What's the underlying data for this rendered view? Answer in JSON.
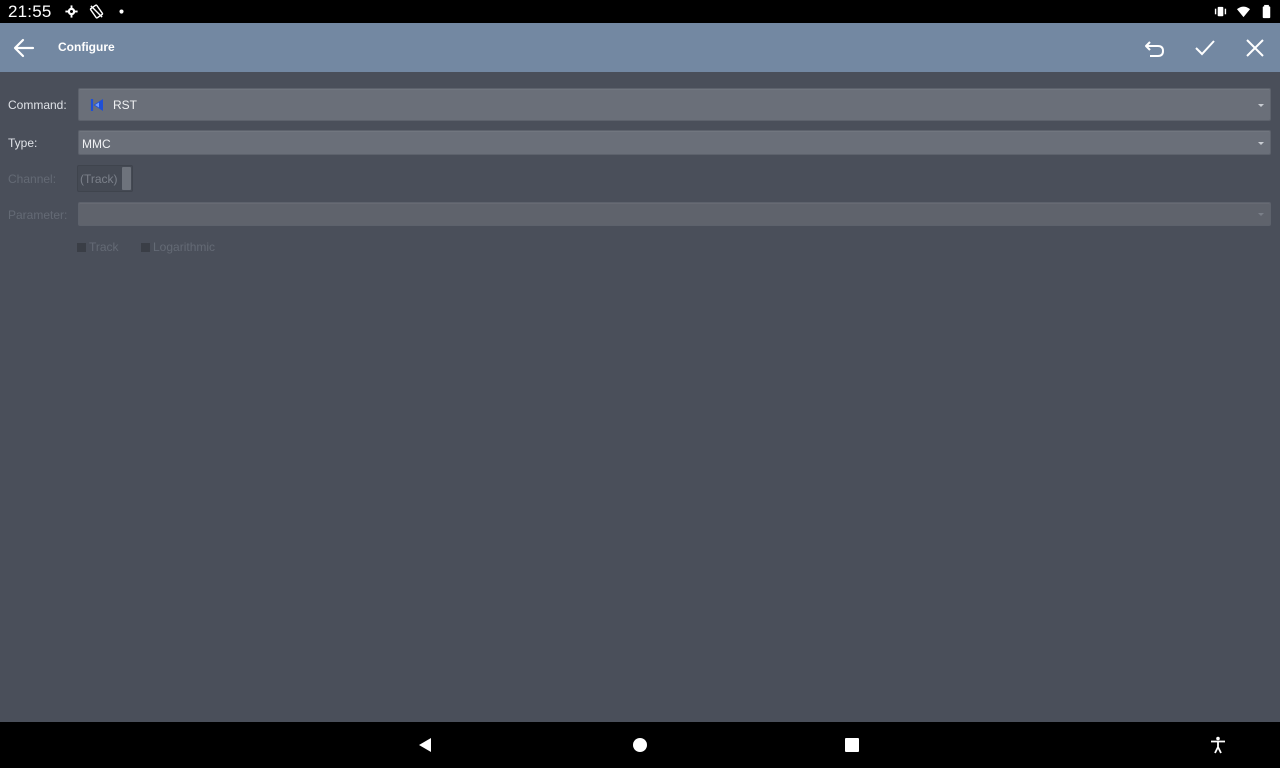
{
  "status_bar": {
    "time": "21:55"
  },
  "app_bar": {
    "title": "Configure"
  },
  "form": {
    "command": {
      "label": "Command:",
      "value": "RST"
    },
    "type": {
      "label": "Type:",
      "value": "MMC"
    },
    "channel": {
      "label": "Channel:",
      "value": "(Track)"
    },
    "parameter": {
      "label": "Parameter:",
      "value": ""
    },
    "checkboxes": [
      {
        "label": "Track",
        "checked": false
      },
      {
        "label": "Logarithmic",
        "checked": false
      }
    ]
  },
  "colors": {
    "app_bar": "#7388a2",
    "background": "#4a4f5a",
    "rst_icon": "#1f4fd6"
  }
}
